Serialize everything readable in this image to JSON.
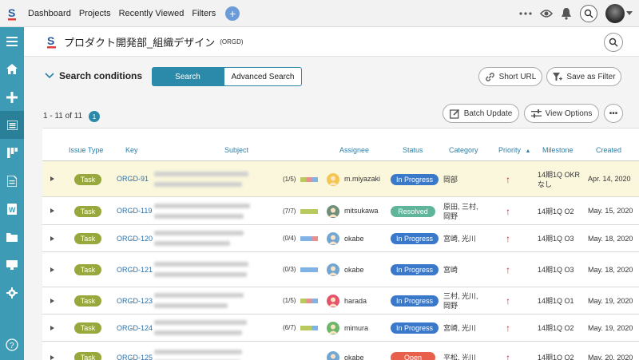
{
  "nav": {
    "items": [
      "Dashboard",
      "Projects",
      "Recently Viewed",
      "Filters"
    ],
    "add_label": "+"
  },
  "project": {
    "name": "プロダクト開発部_組織デザイン",
    "key": "(ORGD)"
  },
  "toolbar": {
    "search_conditions": "Search conditions",
    "search_tab": "Search",
    "advanced_tab": "Advanced Search",
    "short_url": "Short URL",
    "save_filter": "Save as Filter",
    "batch_update": "Batch Update",
    "view_options": "View Options",
    "more": "•••"
  },
  "results": {
    "range": "1 - 11 of 11",
    "page": "1"
  },
  "table": {
    "columns": [
      "Issue Type",
      "Key",
      "Subject",
      "Assignee",
      "Status",
      "Category",
      "Priority",
      "Milestone",
      "Created"
    ],
    "priority_sort_indicator": "▲",
    "rows": [
      {
        "type": "Task",
        "key": "ORGD-91",
        "subtasks": "(1/5)",
        "assignee": "m.miyazaki",
        "status": "In Progress",
        "category": "岡部",
        "priority": "↑",
        "milestone": "14期1Q OKR\nなし",
        "created": "Apr. 14, 2020"
      },
      {
        "type": "Task",
        "key": "ORGD-119",
        "subtasks": "(7/7)",
        "assignee": "mitsukawa",
        "status": "Resolved",
        "category": "原田, 三村,\n岡野",
        "priority": "↑",
        "milestone": "14期1Q O2",
        "created": "May. 15, 2020"
      },
      {
        "type": "Task",
        "key": "ORGD-120",
        "subtasks": "(0/4)",
        "assignee": "okabe",
        "status": "In Progress",
        "category": "宮崎, 光川",
        "priority": "↑",
        "milestone": "14期1Q O3",
        "created": "May. 18, 2020"
      },
      {
        "type": "Task",
        "key": "ORGD-121",
        "subtasks": "(0/3)",
        "assignee": "okabe",
        "status": "In Progress",
        "category": "宮崎",
        "priority": "↑",
        "milestone": "14期1Q O3",
        "created": "May. 18, 2020"
      },
      {
        "type": "Task",
        "key": "ORGD-123",
        "subtasks": "(1/5)",
        "assignee": "harada",
        "status": "In Progress",
        "category": "三村, 光川,\n岡野",
        "priority": "↑",
        "milestone": "14期1Q O1",
        "created": "May. 19, 2020"
      },
      {
        "type": "Task",
        "key": "ORGD-124",
        "subtasks": "(6/7)",
        "assignee": "mimura",
        "status": "In Progress",
        "category": "宮崎, 光川",
        "priority": "↑",
        "milestone": "14期1Q O2",
        "created": "May. 19, 2020"
      },
      {
        "type": "Task",
        "key": "ORGD-125",
        "subtasks": "",
        "assignee": "okabe",
        "status": "Open",
        "category": "平松, 光川",
        "priority": "↑",
        "milestone": "14期1Q O2",
        "created": "May. 20, 2020"
      }
    ]
  },
  "colors": {
    "accent": "#2b8aaa",
    "sidebar": "#3d9bb6",
    "task_badge": "#99a83c",
    "in_progress": "#3a78c9",
    "resolved": "#5fb59a",
    "open": "#e8604c",
    "priority_high": "#d9203a"
  }
}
